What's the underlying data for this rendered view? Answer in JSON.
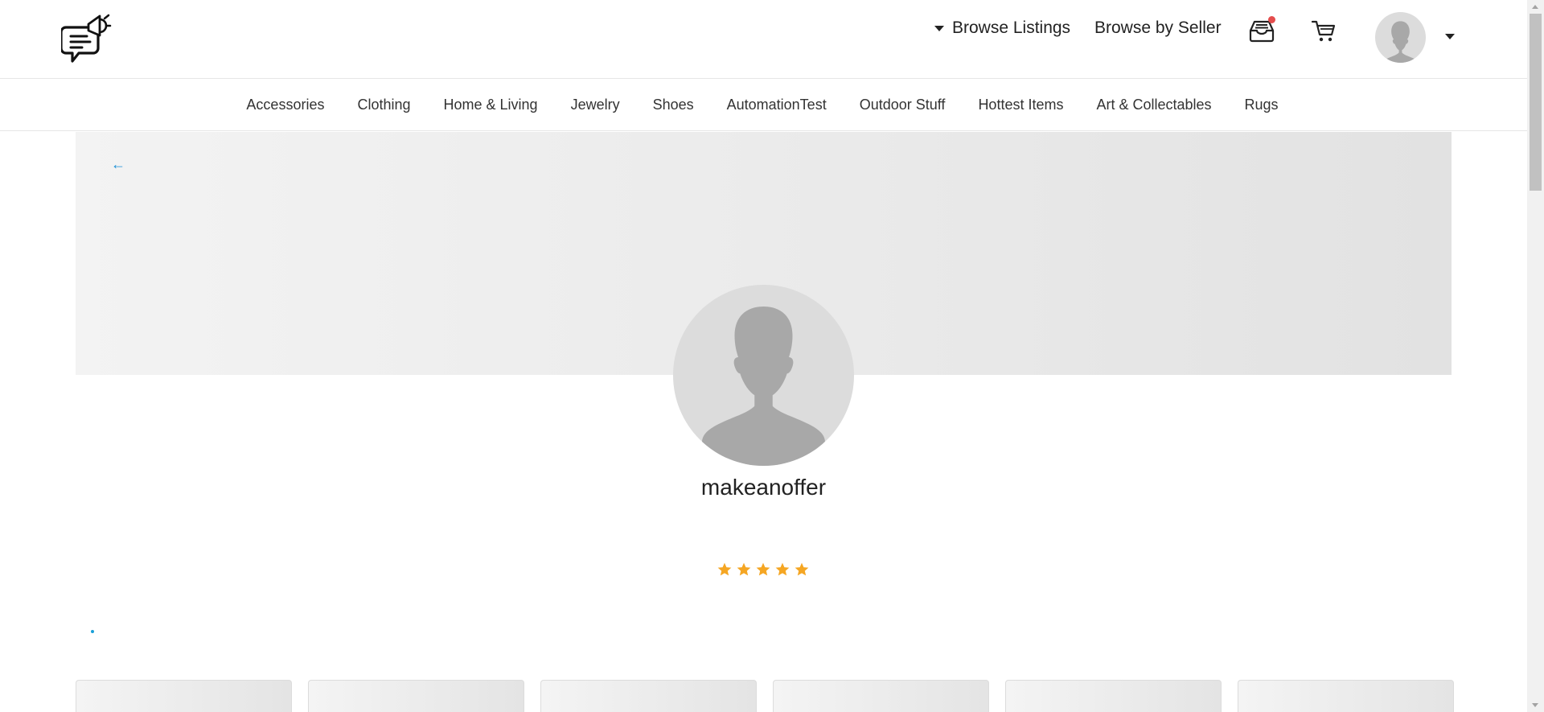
{
  "header": {
    "logo_icon": "chat-megaphone-icon",
    "browse_listings_label": "Browse Listings",
    "browse_by_seller_label": "Browse by Seller",
    "inbox_icon": "inbox-icon",
    "cart_icon": "cart-icon",
    "notification_color": "#e44d4d"
  },
  "categories": [
    "Accessories",
    "Clothing",
    "Home & Living",
    "Jewelry",
    "Shoes",
    "AutomationTest",
    "Outdoor Stuff",
    "Hottest Items",
    "Art & Collectables",
    "Rugs"
  ],
  "profile": {
    "back_arrow": "←",
    "username": "makeanoffer",
    "rating": 5,
    "rating_max": 5,
    "star_color": "#f5a623"
  },
  "accent_color": "#1a8fd6"
}
